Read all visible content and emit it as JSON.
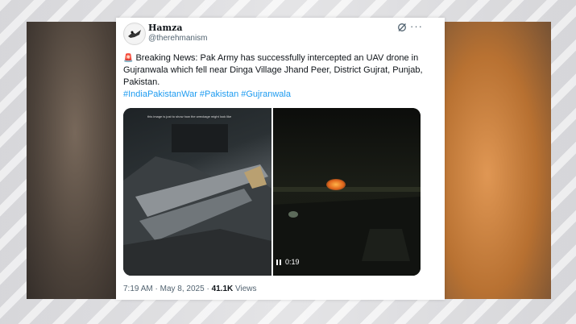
{
  "author": {
    "display_name": "Hamza",
    "handle": "@therehmanism"
  },
  "tweet": {
    "emoji": "🚨",
    "text": "Breaking News: Pak Army has successfully intercepted an UAV drone in Gujranwala which fell near Dinga Village Jhand Peer, District Gujrat, Punjab, Pakistan.",
    "hashtags": [
      "#IndiaPakistanWar",
      "#Pakistan",
      "#Gujranwala"
    ]
  },
  "media": {
    "left_caption": "this image is just to show how the wreckage might look like",
    "video_time": "0:19"
  },
  "meta": {
    "time": "7:19 AM",
    "separator": "·",
    "date": "May 8, 2025",
    "views_count": "41.1K",
    "views_label": "Views"
  },
  "icons": {
    "grok": "grok-icon",
    "more": "more-options-icon",
    "pause": "pause-icon"
  },
  "colors": {
    "link": "#1d9bf0",
    "text": "#0f1419",
    "muted": "#536471"
  }
}
